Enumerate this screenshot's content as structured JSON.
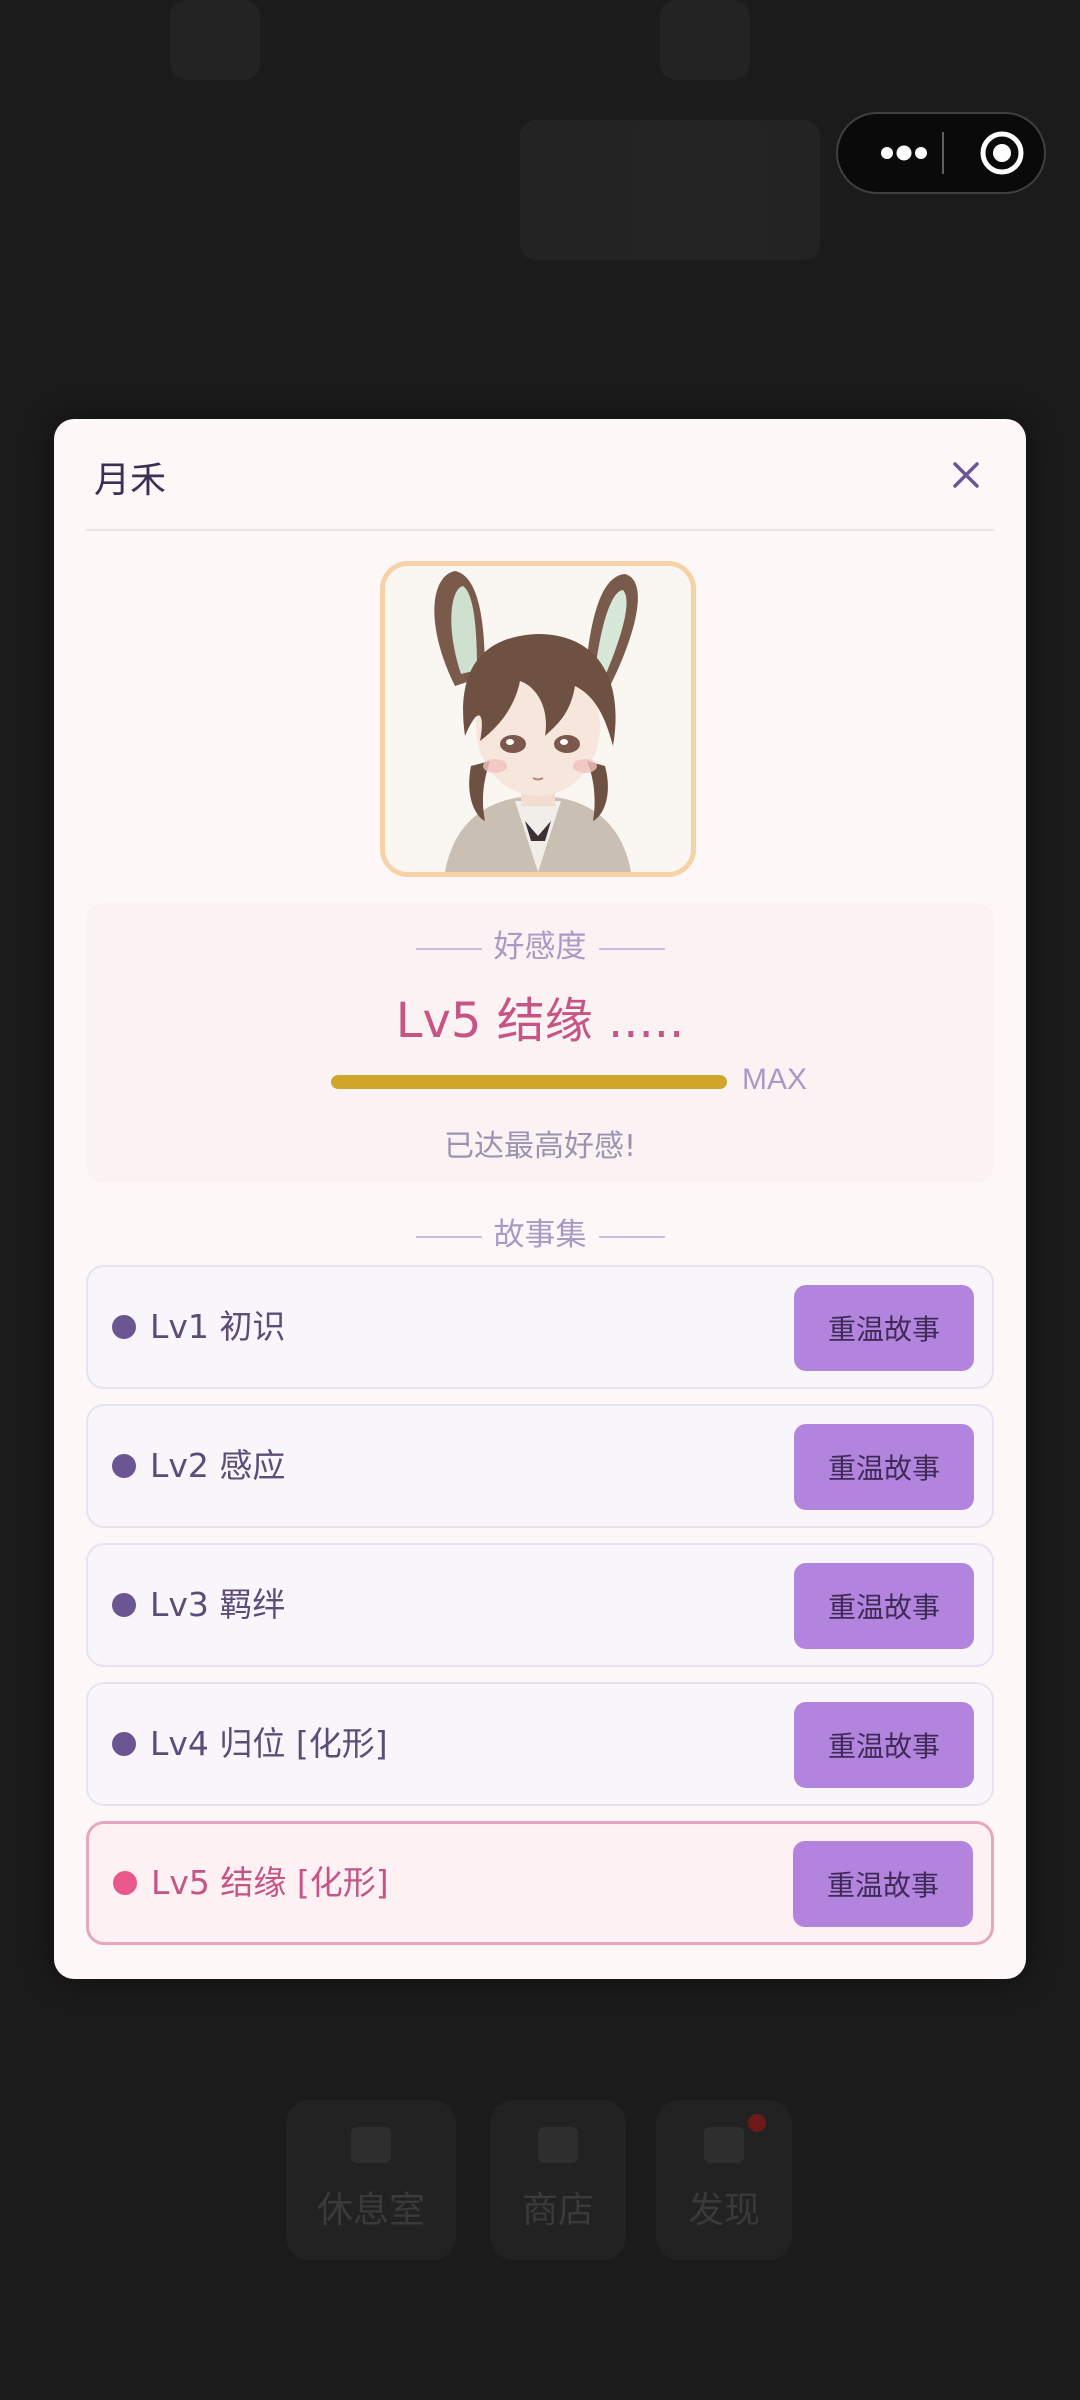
{
  "capsule": {
    "more_icon": "more-dots-icon",
    "close_icon": "record-target-icon"
  },
  "tabbar": {
    "items": [
      {
        "label": "休息室",
        "icon": "book-icon"
      },
      {
        "label": "商店",
        "icon": "shop-icon"
      },
      {
        "label": "发现",
        "icon": "mail-icon"
      }
    ]
  },
  "modal": {
    "title": "月禾",
    "close_icon": "close-icon",
    "affinity": {
      "section_label": "好感度",
      "level": "Lv5 结缘 .....",
      "progress": 1.0,
      "progress_label": "MAX",
      "note": "已达最高好感!"
    },
    "stories": {
      "section_label": "故事集",
      "items": [
        {
          "name": "Lv1 初识",
          "button": "重温故事"
        },
        {
          "name": "Lv2 感应",
          "button": "重温故事"
        },
        {
          "name": "Lv3 羁绊",
          "button": "重温故事"
        },
        {
          "name": "Lv4 归位 [化形]",
          "button": "重温故事"
        },
        {
          "name": "Lv5 结缘 [化形]",
          "button": "重温故事"
        }
      ]
    }
  },
  "colors": {
    "accent_pink": "#c65484",
    "button_purple": "#b384de",
    "progress_gold": "#cfa52a"
  }
}
